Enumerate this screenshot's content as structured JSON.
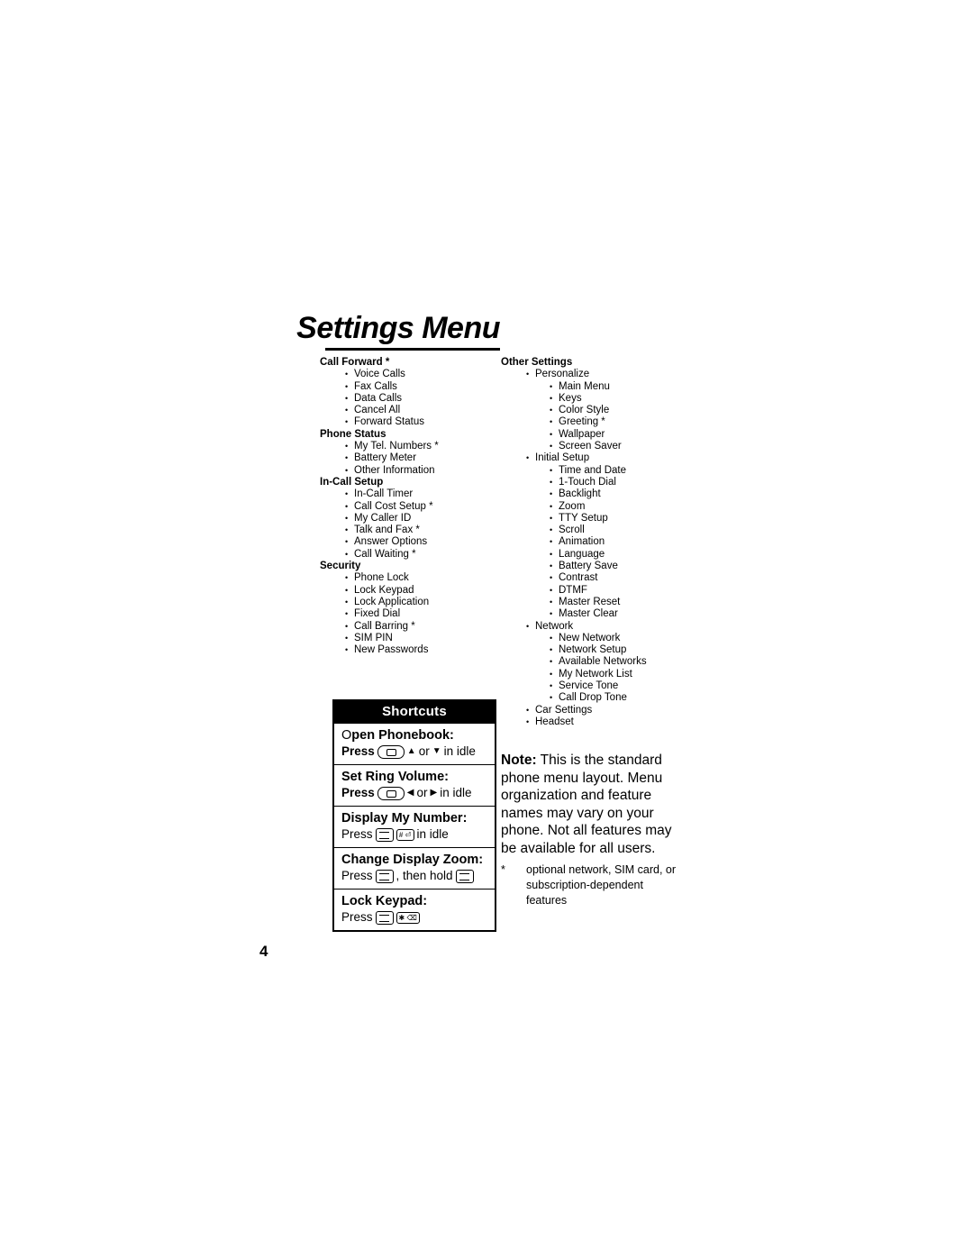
{
  "page": {
    "title": "Settings Menu",
    "page_number": "4"
  },
  "menu_left": [
    {
      "heading": "Call Forward *",
      "items": [
        {
          "label": "Voice Calls"
        },
        {
          "label": "Fax Calls"
        },
        {
          "label": "Data Calls"
        },
        {
          "label": "Cancel All"
        },
        {
          "label": "Forward Status"
        }
      ]
    },
    {
      "heading": "Phone Status",
      "items": [
        {
          "label": "My Tel. Numbers *"
        },
        {
          "label": "Battery Meter"
        },
        {
          "label": "Other Information"
        }
      ]
    },
    {
      "heading": "In-Call Setup",
      "items": [
        {
          "label": "In-Call Timer"
        },
        {
          "label": "Call Cost Setup *"
        },
        {
          "label": "My Caller ID"
        },
        {
          "label": "Talk and Fax *"
        },
        {
          "label": "Answer Options"
        },
        {
          "label": "Call Waiting *"
        }
      ]
    },
    {
      "heading": "Security",
      "items": [
        {
          "label": "Phone Lock"
        },
        {
          "label": "Lock Keypad"
        },
        {
          "label": "Lock Application"
        },
        {
          "label": "Fixed Dial"
        },
        {
          "label": "Call Barring *"
        },
        {
          "label": "SIM PIN"
        },
        {
          "label": "New Passwords"
        }
      ]
    }
  ],
  "menu_right": {
    "heading": "Other Settings",
    "items": [
      {
        "label": "Personalize",
        "children": [
          "Main Menu",
          "Keys",
          "Color Style",
          "Greeting *",
          "Wallpaper",
          "Screen Saver"
        ]
      },
      {
        "label": "Initial Setup",
        "children": [
          "Time and Date",
          "1-Touch Dial",
          "Backlight",
          "Zoom",
          "TTY Setup",
          "Scroll",
          "Animation",
          "Language",
          "Battery Save",
          "Contrast",
          "DTMF",
          "Master Reset",
          "Master Clear"
        ]
      },
      {
        "label": "Network",
        "children": [
          "New Network",
          "Network Setup",
          "Available Networks",
          "My Network List",
          "Service Tone",
          "Call Drop Tone"
        ]
      },
      {
        "label": "Car Settings",
        "children": []
      },
      {
        "label": "Headset",
        "children": []
      }
    ]
  },
  "shortcuts": {
    "header": "Shortcuts",
    "rows": [
      {
        "title_lead": "O",
        "title_rest": "pen Phonebook:",
        "press_label": "Press",
        "keys": [
          "nav-key-icon",
          "up-arrow-icon",
          "or",
          "down-arrow-icon"
        ],
        "suffix": "in idle"
      },
      {
        "title_lead": "",
        "title_rest": "Set Ring Volume:",
        "press_label": "Press",
        "keys": [
          "nav-key-icon",
          "left-arrow-icon",
          "or",
          "right-arrow-icon"
        ],
        "suffix": "in idle"
      },
      {
        "title_lead": "",
        "title_rest": "Display My Number:",
        "press_label": "Press",
        "keys": [
          "menu-key-icon",
          "pound-key-icon"
        ],
        "suffix": "in idle"
      },
      {
        "title_lead": "",
        "title_rest": "Change Display Zoom:",
        "press_label": "Press",
        "keys": [
          "menu-key-icon"
        ],
        "suffix": ", then hold",
        "trailing_key": "menu-key-icon"
      },
      {
        "title_lead": "",
        "title_rest": "Lock Keypad:",
        "press_label": "Press",
        "keys": [
          "menu-key-icon",
          "star-key-icon"
        ],
        "suffix": ""
      }
    ],
    "key_labels": {
      "pound": "# ⏎",
      "star": "✱ ⌫"
    }
  },
  "note": {
    "label": "Note:",
    "text": " This is the standard phone menu layout. Menu organization and feature names may vary on your phone. Not all features may be available for all users."
  },
  "footnote": {
    "marker": "*",
    "text": "optional network, SIM card, or subscription-dependent features"
  }
}
